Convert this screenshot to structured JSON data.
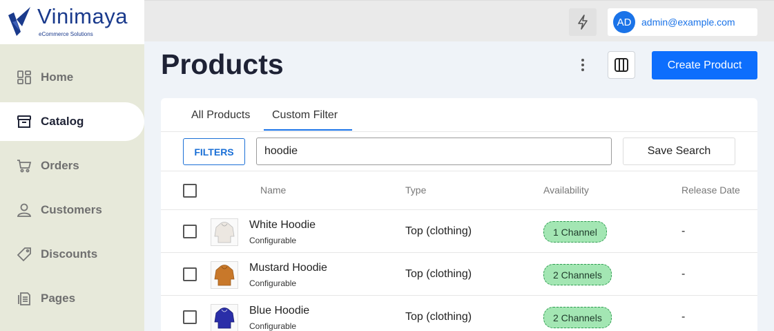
{
  "brand": {
    "name": "Vinimaya",
    "tagline": "eCommerce Solutions"
  },
  "sidebar": {
    "items": [
      {
        "label": "Home",
        "icon": "grid-icon"
      },
      {
        "label": "Catalog",
        "icon": "box-icon",
        "active": true
      },
      {
        "label": "Orders",
        "icon": "cart-icon"
      },
      {
        "label": "Customers",
        "icon": "user-icon"
      },
      {
        "label": "Discounts",
        "icon": "tag-icon"
      },
      {
        "label": "Pages",
        "icon": "document-icon"
      }
    ]
  },
  "topbar": {
    "avatar_initials": "AD",
    "user_email": "admin@example.com"
  },
  "page": {
    "title": "Products",
    "create_label": "Create Product"
  },
  "tabs": [
    {
      "label": "All Products"
    },
    {
      "label": "Custom Filter",
      "active": true
    }
  ],
  "toolbar": {
    "filters_label": "FILTERS",
    "search_value": "hoodie",
    "save_search_label": "Save Search"
  },
  "table": {
    "columns": [
      "Name",
      "Type",
      "Availability",
      "Release Date"
    ],
    "rows": [
      {
        "name": "White Hoodie",
        "variant": "Configurable",
        "type": "Top (clothing)",
        "availability": "1 Channel",
        "release_date": "-",
        "color": "#ece7e1"
      },
      {
        "name": "Mustard Hoodie",
        "variant": "Configurable",
        "type": "Top (clothing)",
        "availability": "2 Channels",
        "release_date": "-",
        "color": "#c8782a"
      },
      {
        "name": "Blue Hoodie",
        "variant": "Configurable",
        "type": "Top (clothing)",
        "availability": "2 Channels",
        "release_date": "-",
        "color": "#2a2ea8"
      }
    ]
  },
  "colors": {
    "accent": "#0d6efd",
    "sidebar_bg": "#e7e9da",
    "badge_bg": "#a3e6b3",
    "brand": "#1a3a8c"
  }
}
